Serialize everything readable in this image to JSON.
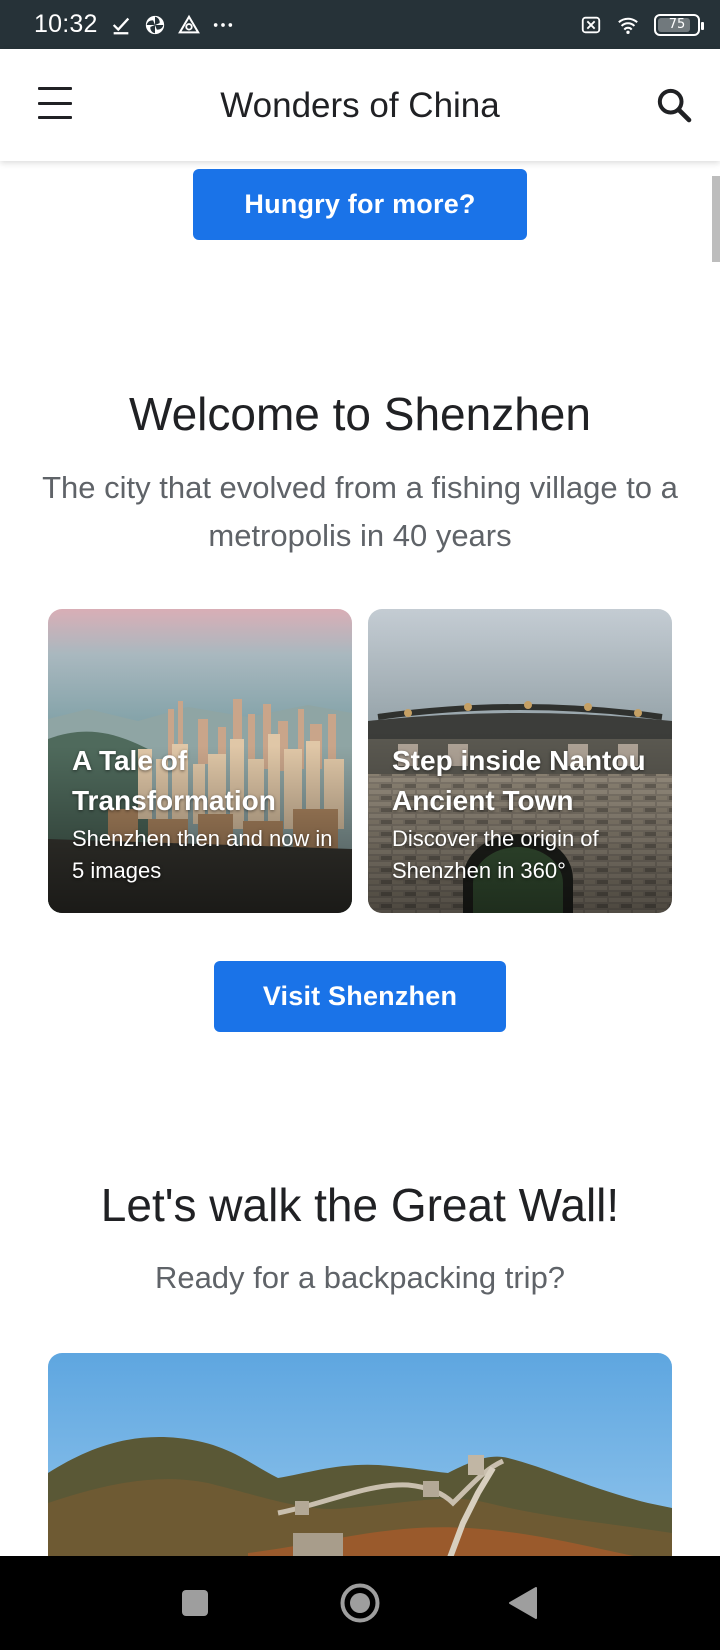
{
  "status_bar": {
    "time": "10:32",
    "battery": "75",
    "battery_level": 0.75,
    "icons_left": [
      "check-download-icon",
      "pinwheel-icon",
      "triangle-icon",
      "more-dots-icon"
    ],
    "icons_right": [
      "no-sim-icon",
      "wifi-icon",
      "battery-icon"
    ]
  },
  "app_bar": {
    "title": "Wonders of China",
    "menu_icon": "hamburger-menu-icon",
    "search_icon": "search-icon"
  },
  "content": {
    "hungry_button": "Hungry for more?",
    "shenzhen": {
      "title": "Welcome to Shenzhen",
      "subtitle": "The city that evolved from a fishing village to a metropolis in 40 years",
      "cards": [
        {
          "title": "A Tale of Transformation",
          "description": "Shenzhen then and now in 5 images"
        },
        {
          "title": "Step inside Nantou Ancient Town",
          "description": "Discover the origin of Shenzhen in 360°"
        }
      ],
      "visit_button": "Visit Shenzhen"
    },
    "great_wall": {
      "title": "Let's walk the Great Wall!",
      "subtitle": "Ready for a backpacking trip?"
    }
  },
  "nav_bar": {
    "buttons": [
      "recents-square-icon",
      "home-circle-icon",
      "back-triangle-icon"
    ]
  },
  "colors": {
    "accent": "#1a73e8",
    "status_bar_bg": "#263238",
    "nav_bar_bg": "#000000"
  }
}
